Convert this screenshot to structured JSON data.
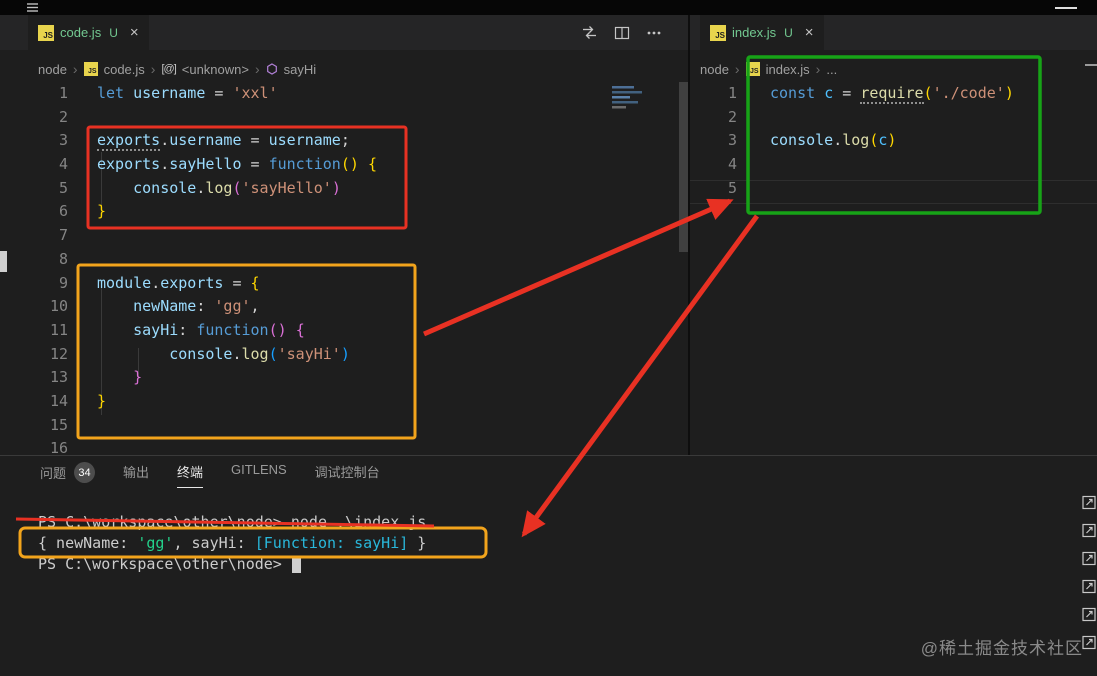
{
  "ui": {
    "chevron": "›",
    "close_glyph": "×",
    "js_badge": "JS",
    "more_dots": "···"
  },
  "tabs": {
    "left": {
      "file": "code.js",
      "git_status": "U"
    },
    "right": {
      "file": "index.js",
      "git_status": "U"
    }
  },
  "breadcrumbs": {
    "left": {
      "items": [
        "node",
        "code.js",
        "<unknown>",
        "sayHi"
      ]
    },
    "right": {
      "items": [
        "node",
        "index.js",
        "..."
      ]
    }
  },
  "palette": {
    "code": {
      "kw": "#569cd6",
      "v": "#9cdcfe",
      "cv": "#4fc1ff",
      "s": "#ce9178",
      "f": "#dcdcaa",
      "p": "#d4d4d4",
      "b1": "#ffd700",
      "b2": "#da70d6",
      "b3": "#179fff"
    },
    "terminal": {
      "t": "#cccccc",
      "g": "#23d18b",
      "c": "#29b8db"
    }
  },
  "editors": {
    "left": {
      "lines": [
        {
          "n": 1,
          "tokens": [
            [
              "let ",
              "kw"
            ],
            [
              "username",
              "v"
            ],
            [
              " = ",
              "p"
            ],
            [
              "'xxl'",
              "s"
            ]
          ]
        },
        {
          "n": 2,
          "tokens": []
        },
        {
          "n": 3,
          "tokens": [
            [
              "exports",
              "v_u"
            ],
            [
              ".",
              "p"
            ],
            [
              "username",
              "v"
            ],
            [
              " = ",
              "p"
            ],
            [
              "username",
              "v"
            ],
            [
              ";",
              "p"
            ]
          ]
        },
        {
          "n": 4,
          "tokens": [
            [
              "exports",
              "v"
            ],
            [
              ".",
              "p"
            ],
            [
              "sayHello",
              "v"
            ],
            [
              " = ",
              "p"
            ],
            [
              "function",
              "kw"
            ],
            [
              "()",
              "b1"
            ],
            [
              " ",
              "p"
            ],
            [
              "{",
              "b1"
            ]
          ]
        },
        {
          "n": 5,
          "tokens": [
            [
              "    ",
              "p"
            ],
            [
              "console",
              "v"
            ],
            [
              ".",
              "p"
            ],
            [
              "log",
              "f"
            ],
            [
              "(",
              "b2"
            ],
            [
              "'sayHello'",
              "s"
            ],
            [
              ")",
              "b2"
            ]
          ]
        },
        {
          "n": 6,
          "tokens": [
            [
              "}",
              "b1"
            ]
          ]
        },
        {
          "n": 7,
          "tokens": []
        },
        {
          "n": 8,
          "tokens": []
        },
        {
          "n": 9,
          "tokens": [
            [
              "module",
              "v"
            ],
            [
              ".",
              "p"
            ],
            [
              "exports",
              "v"
            ],
            [
              " = ",
              "p"
            ],
            [
              "{",
              "b1"
            ]
          ]
        },
        {
          "n": 10,
          "tokens": [
            [
              "    ",
              "p"
            ],
            [
              "newName",
              "v"
            ],
            [
              ": ",
              "p"
            ],
            [
              "'gg'",
              "s"
            ],
            [
              ",",
              "p"
            ]
          ]
        },
        {
          "n": 11,
          "tokens": [
            [
              "    ",
              "p"
            ],
            [
              "sayHi",
              "v"
            ],
            [
              ": ",
              "p"
            ],
            [
              "function",
              "kw"
            ],
            [
              "()",
              "b2"
            ],
            [
              " ",
              "p"
            ],
            [
              "{",
              "b2"
            ]
          ]
        },
        {
          "n": 12,
          "tokens": [
            [
              "        ",
              "p"
            ],
            [
              "console",
              "v"
            ],
            [
              ".",
              "p"
            ],
            [
              "log",
              "f"
            ],
            [
              "(",
              "b3"
            ],
            [
              "'sayHi'",
              "s"
            ],
            [
              ")",
              "b3"
            ]
          ]
        },
        {
          "n": 13,
          "tokens": [
            [
              "    ",
              "p"
            ],
            [
              "}",
              "b2"
            ]
          ]
        },
        {
          "n": 14,
          "tokens": [
            [
              "}",
              "b1"
            ]
          ]
        },
        {
          "n": 15,
          "tokens": []
        },
        {
          "n": 16,
          "tokens": []
        }
      ]
    },
    "right": {
      "lines": [
        {
          "n": 1,
          "tokens": [
            [
              "const ",
              "kw"
            ],
            [
              "c",
              "cv"
            ],
            [
              " = ",
              "p"
            ],
            [
              "require",
              "f_u"
            ],
            [
              "(",
              "b1"
            ],
            [
              "'./code'",
              "s"
            ],
            [
              ")",
              "b1"
            ]
          ]
        },
        {
          "n": 2,
          "tokens": []
        },
        {
          "n": 3,
          "tokens": [
            [
              "console",
              "v"
            ],
            [
              ".",
              "p"
            ],
            [
              "log",
              "f"
            ],
            [
              "(",
              "b1"
            ],
            [
              "c",
              "cv"
            ],
            [
              ")",
              "b1"
            ]
          ]
        },
        {
          "n": 4,
          "tokens": []
        },
        {
          "n": 5,
          "tokens": []
        }
      ]
    }
  },
  "panel": {
    "tabs": [
      {
        "label": "问题",
        "badge": "34"
      },
      {
        "label": "输出"
      },
      {
        "label": "终端"
      },
      {
        "label": "GITLENS"
      },
      {
        "label": "调试控制台"
      }
    ],
    "active_index": 2
  },
  "terminal": {
    "lines": [
      {
        "tokens": [
          [
            "PS C:\\workspace\\other\\node> node .\\index.js",
            "t"
          ]
        ]
      },
      {
        "tokens": [
          [
            "{ newName: ",
            "t"
          ],
          [
            "'gg'",
            "g"
          ],
          [
            ", sayHi: ",
            "t"
          ],
          [
            "[Function: sayHi]",
            "c"
          ],
          [
            " }",
            "t"
          ]
        ]
      },
      {
        "tokens": [
          [
            "PS C:\\workspace\\other\\node> ",
            "t"
          ],
          [
            "",
            "cursor"
          ]
        ]
      }
    ]
  },
  "watermark": "@稀土掘金技术社区",
  "annotations": {
    "red": "#e83123",
    "orange": "#f2a41c",
    "green": "#17a317"
  }
}
